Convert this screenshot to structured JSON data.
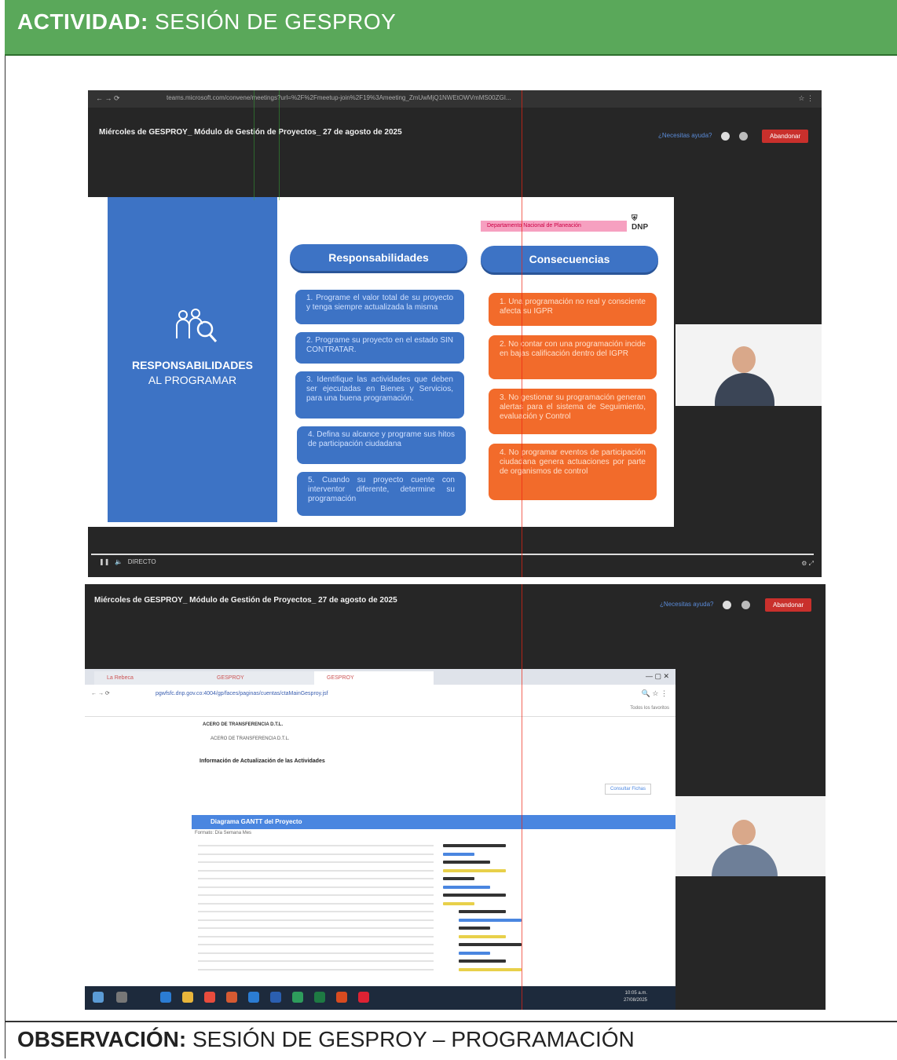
{
  "header": {
    "label": "ACTIVIDAD:",
    "text": "SESIÓN DE GESPROY",
    "color": "#5aa85a"
  },
  "observation": {
    "label": "OBSERVACIÓN:",
    "text": "SESIÓN DE GESPROY – PROGRAMACIÓN"
  },
  "shot1": {
    "url": "teams.microsoft.com/convene/meetings?url=%2F%2Fmeetup-join%2F19%3Ameeting_ZmUwMjQ1NWEtOWVmMS00ZGI...",
    "meeting_title": "Miércoles de GESPROY_ Módulo de Gestión de Proyectos_ 27 de agosto de 2025",
    "help": "¿Necesitas ayuda?",
    "leave": "Abandonar",
    "slide": {
      "left_title_1": "RESPONSABILIDADES",
      "left_title_2": "AL PROGRAMAR",
      "pink_bar": "Departamento Nacional de Planeación",
      "logo": "DNP",
      "col1_title": "Responsabilidades",
      "col2_title": "Consecuencias",
      "responsabilidades": [
        "1. Programe el valor total de su proyecto y tenga siempre actualizada la misma",
        "2. Programe su proyecto en el estado SIN CONTRATAR.",
        "3. Identifique las actividades que deben ser ejecutadas en Bienes y Servicios, para una buena programación.",
        "4. Defina su alcance y programe sus hitos de participación ciudadana",
        "5. Cuando su proyecto cuente con interventor diferente, determine su programación"
      ],
      "consecuencias": [
        "1. Una programación no real y consciente afecta su IGPR",
        "2. No contar con una programación incide en bajas calificación dentro del IGPR",
        "3. No gestionar su programación generan alertas para el sistema de Seguimiento, evaluación y Control",
        "4. No programar eventos de participación ciudadana genera actuaciones por parte de organismos de control"
      ]
    },
    "live_label": "DIRECTO"
  },
  "shot2": {
    "meeting_title": "Miércoles de GESPROY_ Módulo de Gestión de Proyectos_ 27 de agosto de 2025",
    "help": "¿Necesitas ayuda?",
    "leave": "Abandonar",
    "tabs": [
      "La Rebeca",
      "GESPROY",
      "GESPROY"
    ],
    "address": "pgwfsfc.dnp.gov.co:4004/gp/faces/paginas/cuentas/ctaMainGesproy.jsf",
    "bookmarks": "Todos los favoritos",
    "row_head": "ACERO DE TRANSFERENCIA D.T.L.",
    "row_sub": "ACERO DE TRANSFERENCIA D.T.L.",
    "section_title": "Información de Actualización de las Actividades",
    "consult_button": "Consultar Fichas",
    "gantt_title": "Diagrama GANTT del Proyecto",
    "gantt_format": "Formato: Día Semana Mes",
    "time": "10:05 a.m.",
    "date": "27/08/2025"
  }
}
